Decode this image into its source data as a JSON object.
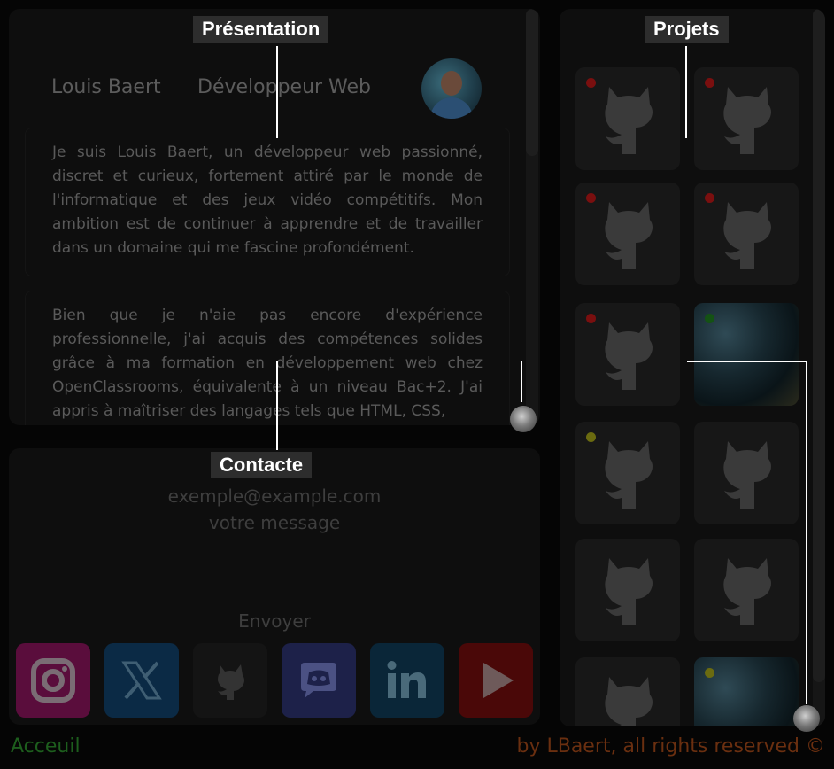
{
  "labels": {
    "presentation": "Présentation",
    "projects": "Projets",
    "contact": "Contacte"
  },
  "profile": {
    "name": "Louis Baert",
    "role": "Développeur Web"
  },
  "presentation_paragraphs": [
    "Je suis Louis Baert, un développeur web passionné, discret et curieux, fortement attiré par le monde de l'informatique et des jeux vidéo compétitifs. Mon ambition est de continuer à apprendre et de travailler dans un domaine qui me fascine profondément.",
    "Bien que je n'aie pas encore d'expérience professionnelle, j'ai acquis des compétences solides grâce à ma formation en développement web chez OpenClassrooms, équivalente à un niveau Bac+2. J'ai appris à maîtriser des langages tels que HTML, CSS,"
  ],
  "contact": {
    "email_placeholder": "exemple@example.com",
    "message_placeholder": "votre message",
    "send_label": "Envoyer"
  },
  "socials": [
    {
      "name": "instagram",
      "icon": "instagram-icon",
      "color": "#5a0d3c"
    },
    {
      "name": "x",
      "icon": "x-icon",
      "color": "#0b2a45"
    },
    {
      "name": "github",
      "icon": "github-icon",
      "color": "#141414"
    },
    {
      "name": "discord",
      "icon": "discord-icon",
      "color": "#1d2149"
    },
    {
      "name": "linkedin",
      "icon": "linkedin-icon",
      "color": "#0a2638"
    },
    {
      "name": "youtube",
      "icon": "youtube-icon",
      "color": "#4a0808"
    }
  ],
  "project_status_colors": {
    "red": "#7a0f0f",
    "green": "#145214",
    "yellow": "#6b6b10"
  },
  "footer": {
    "home": "Acceuil",
    "copyright": "by LBaert, all rights reserved ©"
  }
}
